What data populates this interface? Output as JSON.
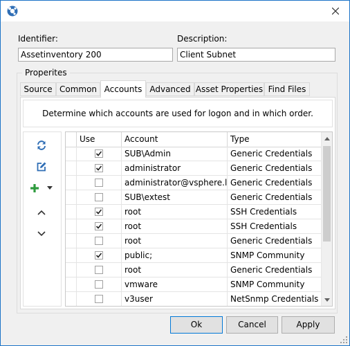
{
  "window": {
    "title": ""
  },
  "fields": {
    "identifier_label": "Identifier:",
    "identifier_value": "Assetinventory 200",
    "description_label": "Description:",
    "description_value": "Client Subnet"
  },
  "group_title": "Properites",
  "tabs": [
    {
      "label": "Source",
      "active": false
    },
    {
      "label": "Common",
      "active": false
    },
    {
      "label": "Accounts",
      "active": true
    },
    {
      "label": "Advanced",
      "active": false
    },
    {
      "label": "Asset Properties",
      "active": false
    },
    {
      "label": "Find Files",
      "active": false
    }
  ],
  "accounts_description": "Determine which accounts are used for logon and in which order.",
  "toolbar_icons": [
    "refresh-icon",
    "edit-icon",
    "add-icon",
    "dropdown-arrow-icon",
    "move-up-icon",
    "move-down-icon"
  ],
  "grid": {
    "columns": [
      "Use",
      "Account",
      "Type"
    ],
    "rows": [
      {
        "use": true,
        "account": "SUB\\Admin",
        "type": "Generic Credentials"
      },
      {
        "use": true,
        "account": "administrator",
        "type": "Generic Credentials"
      },
      {
        "use": false,
        "account": "administrator@vsphere.local",
        "type": "Generic Credentials"
      },
      {
        "use": false,
        "account": "SUB\\extest",
        "type": "Generic Credentials"
      },
      {
        "use": true,
        "account": "root",
        "type": "SSH Credentials"
      },
      {
        "use": true,
        "account": "root",
        "type": "SSH Credentials"
      },
      {
        "use": false,
        "account": "root",
        "type": "Generic Credentials"
      },
      {
        "use": true,
        "account": "public;",
        "type": "SNMP Community"
      },
      {
        "use": false,
        "account": "root",
        "type": "Generic Credentials"
      },
      {
        "use": false,
        "account": "vmware",
        "type": "SNMP Community"
      },
      {
        "use": false,
        "account": "v3user",
        "type": "NetSnmp Credentials"
      }
    ]
  },
  "buttons": {
    "ok": "Ok",
    "cancel": "Cancel",
    "apply": "Apply"
  },
  "colors": {
    "accent": "#1b73c7",
    "icon_blue": "#2f6eb5",
    "add_green": "#2e9b3e"
  }
}
